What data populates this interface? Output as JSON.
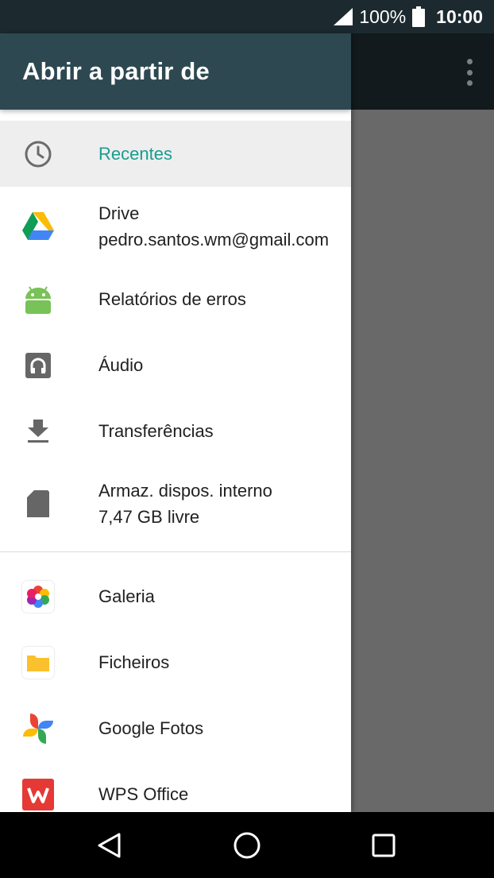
{
  "status_bar": {
    "battery": "100%",
    "time": "10:00"
  },
  "drawer": {
    "title": "Abrir a partir de",
    "roots": [
      {
        "label": "Recentes",
        "icon": "clock-icon",
        "selected": true
      },
      {
        "label": "Drive",
        "subtitle": "pedro.santos.wm@gmail.com",
        "icon": "google-drive-icon"
      },
      {
        "label": "Relatórios de erros",
        "icon": "android-icon"
      },
      {
        "label": "Áudio",
        "icon": "headphones-icon"
      },
      {
        "label": "Transferências",
        "icon": "download-icon"
      },
      {
        "label": "Armaz. dispos. interno",
        "subtitle": "7,47 GB livre",
        "icon": "sd-card-icon"
      }
    ],
    "apps": [
      {
        "label": "Galeria",
        "icon": "gallery-icon"
      },
      {
        "label": "Ficheiros",
        "icon": "folder-icon"
      },
      {
        "label": "Google Fotos",
        "icon": "google-photos-icon"
      },
      {
        "label": "WPS Office",
        "icon": "wps-office-icon"
      }
    ]
  },
  "colors": {
    "header": "#2d4851",
    "accent": "#1a9c8f",
    "selected_bg": "#eeeeee",
    "scrim": "#696969"
  }
}
